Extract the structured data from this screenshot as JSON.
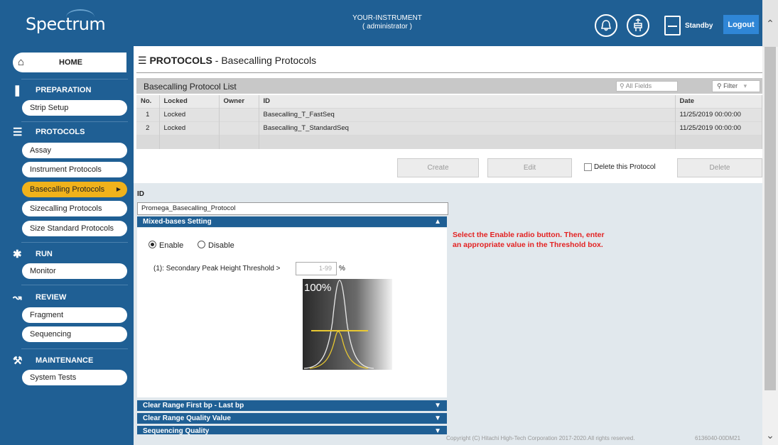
{
  "header": {
    "logo_text": "Spectrum",
    "instrument_name": "YOUR-INSTRUMENT",
    "user_role": "( administrator )",
    "status": "Standby",
    "logout_label": "Logout",
    "icons": [
      "bell-icon",
      "cassette-icon",
      "standby-icon"
    ]
  },
  "sidebar": {
    "home_label": "HOME",
    "sections": [
      {
        "title": "PREPARATION",
        "icon": "pipette-icon",
        "items": [
          "Strip Setup"
        ]
      },
      {
        "title": "PROTOCOLS",
        "icon": "list-icon",
        "items": [
          "Assay",
          "Instrument Protocols",
          "Basecalling Protocols",
          "Sizecalling Protocols",
          "Size Standard Protocols"
        ]
      },
      {
        "title": "RUN",
        "icon": "run-icon",
        "items": [
          "Monitor"
        ]
      },
      {
        "title": "REVIEW",
        "icon": "chart-icon",
        "items": [
          "Fragment",
          "Sequencing"
        ]
      },
      {
        "title": "MAINTENANCE",
        "icon": "wrench-icon",
        "items": [
          "System Tests"
        ]
      }
    ],
    "active_item": "Basecalling Protocols",
    "accent_color": "#f0b21b"
  },
  "main": {
    "title_section": "PROTOCOLS",
    "title_sub": " - Basecalling Protocols",
    "list": {
      "title": "Basecalling Protocol List",
      "search_placeholder": "All Fields",
      "filter_label": "Filter",
      "columns": [
        "No.",
        "Locked",
        "Owner",
        "ID",
        "Date"
      ],
      "rows": [
        {
          "no": "1",
          "locked": "Locked",
          "owner": "",
          "id": "Basecalling_T_FastSeq",
          "date": "11/25/2019 00:00:00"
        },
        {
          "no": "2",
          "locked": "Locked",
          "owner": "",
          "id": "Basecalling_T_StandardSeq",
          "date": "11/25/2019 00:00:00"
        }
      ]
    },
    "buttons": {
      "create": "Create",
      "edit": "Edit",
      "delete_checkbox": "Delete this Protocol",
      "delete": "Delete"
    },
    "detail": {
      "id_label": "ID",
      "id_value": "Promega_Basecalling_Protocol",
      "mixed_bases": {
        "title": "Mixed-bases Setting",
        "enable_label": "Enable",
        "disable_label": "Disable",
        "selected": "Enable",
        "threshold_label": "(1): Secondary Peak Height Threshold >",
        "threshold_placeholder": "1-99",
        "threshold_unit": "%",
        "figure_label": "100%"
      },
      "collapsed_sections": [
        "Clear Range First bp - Last bp",
        "Clear Range Quality Value",
        "Sequencing Quality"
      ],
      "note": "Select the Enable radio button. Then, enter an appropriate value in the Threshold box."
    },
    "footer": {
      "copyright": "Copyright (C) Hitachi High-Tech Corporation 2017-2020.All rights reserved.",
      "code": "6136040-00DM21"
    }
  }
}
